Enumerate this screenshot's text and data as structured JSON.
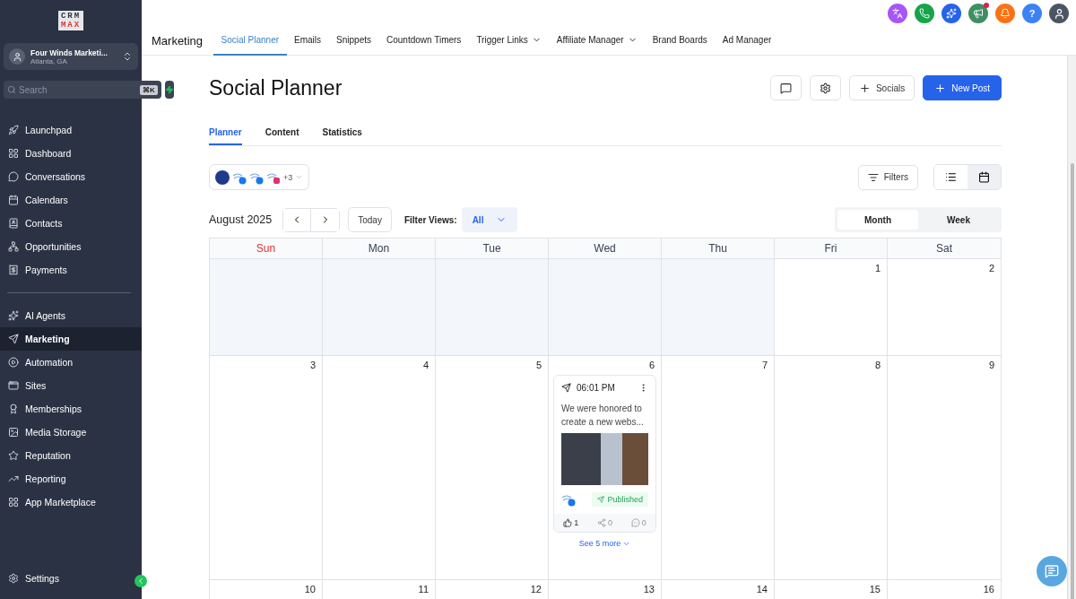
{
  "sidebar": {
    "logo_top": "CRM",
    "logo_bottom": "MAX",
    "workspace": {
      "name": "Four Winds Marketi...",
      "location": "Atlanta, GA"
    },
    "search": {
      "placeholder": "Search",
      "shortcut": "⌘K"
    },
    "items": [
      {
        "label": "Launchpad",
        "selected": false
      },
      {
        "label": "Dashboard",
        "selected": false
      },
      {
        "label": "Conversations",
        "selected": false
      },
      {
        "label": "Calendars",
        "selected": false
      },
      {
        "label": "Contacts",
        "selected": false
      },
      {
        "label": "Opportunities",
        "selected": false
      },
      {
        "label": "Payments",
        "selected": false
      }
    ],
    "items_2": [
      {
        "label": "AI Agents",
        "selected": false
      },
      {
        "label": "Marketing",
        "selected": true
      },
      {
        "label": "Automation",
        "selected": false
      },
      {
        "label": "Sites",
        "selected": false
      },
      {
        "label": "Memberships",
        "selected": false
      },
      {
        "label": "Media Storage",
        "selected": false
      },
      {
        "label": "Reputation",
        "selected": false
      },
      {
        "label": "Reporting",
        "selected": false
      },
      {
        "label": "App Marketplace",
        "selected": false
      }
    ],
    "settings": "Settings"
  },
  "header": {
    "help": "?"
  },
  "nav": {
    "title": "Marketing",
    "tabs": [
      {
        "label": "Social Planner",
        "selected": true,
        "dropdown": false
      },
      {
        "label": "Emails",
        "selected": false,
        "dropdown": false
      },
      {
        "label": "Snippets",
        "selected": false,
        "dropdown": false
      },
      {
        "label": "Countdown Timers",
        "selected": false,
        "dropdown": false
      },
      {
        "label": "Trigger Links",
        "selected": false,
        "dropdown": true
      },
      {
        "label": "Affiliate Manager",
        "selected": false,
        "dropdown": true
      },
      {
        "label": "Brand Boards",
        "selected": false,
        "dropdown": false
      },
      {
        "label": "Ad Manager",
        "selected": false,
        "dropdown": false
      }
    ]
  },
  "page": {
    "title": "Social Planner",
    "socials_button": "Socials",
    "new_post_button": "New Post",
    "tabs": [
      {
        "label": "Planner",
        "selected": true
      },
      {
        "label": "Content",
        "selected": false
      },
      {
        "label": "Statistics",
        "selected": false
      }
    ],
    "accounts": {
      "more": "+3"
    },
    "filters_button": "Filters",
    "view_toggle": [
      {
        "kind": "list",
        "selected": false
      },
      {
        "kind": "calendar",
        "selected": true
      }
    ],
    "month_label": "August 2025",
    "today_button": "Today",
    "filter_views": {
      "label": "Filter Views:",
      "value": "All"
    },
    "range_toggle": [
      {
        "label": "Month",
        "selected": true
      },
      {
        "label": "Week",
        "selected": false
      }
    ]
  },
  "calendar": {
    "days": [
      {
        "label": "Sun",
        "highlighted": true
      },
      {
        "label": "Mon",
        "highlighted": false
      },
      {
        "label": "Tue",
        "highlighted": false
      },
      {
        "label": "Wed",
        "highlighted": false
      },
      {
        "label": "Thu",
        "highlighted": false
      },
      {
        "label": "Fri",
        "highlighted": false
      },
      {
        "label": "Sat",
        "highlighted": false
      }
    ],
    "weeks": [
      [
        {
          "outside": true
        },
        {
          "outside": true
        },
        {
          "outside": true
        },
        {
          "outside": true
        },
        {
          "outside": true
        },
        {
          "date": "1",
          "outside": false
        },
        {
          "date": "2",
          "outside": false
        }
      ],
      [
        {
          "date": "3",
          "outside": false
        },
        {
          "date": "4",
          "outside": false
        },
        {
          "date": "5",
          "outside": false
        },
        {
          "date": "6",
          "outside": false,
          "post": {
            "time": "06:01 PM",
            "text": "We were honored to create a new webs...",
            "status": "Published",
            "likes": "1",
            "shares": "0",
            "comments": "0"
          },
          "see_more": "See 5 more"
        },
        {
          "date": "7",
          "outside": false
        },
        {
          "date": "8",
          "outside": false
        },
        {
          "date": "9",
          "outside": false
        }
      ],
      [
        {
          "date": "10",
          "outside": false
        },
        {
          "date": "11",
          "outside": false
        },
        {
          "date": "12",
          "outside": false
        },
        {
          "date": "13",
          "outside": false
        },
        {
          "date": "14",
          "outside": false
        },
        {
          "date": "15",
          "outside": false
        },
        {
          "date": "16",
          "outside": false
        }
      ]
    ]
  }
}
